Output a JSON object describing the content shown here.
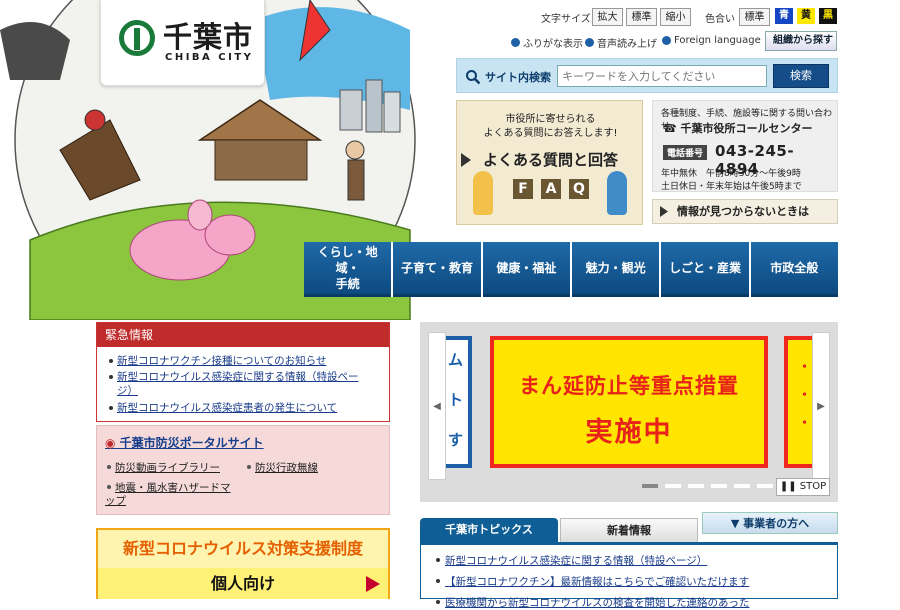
{
  "logo": {
    "ja": "千葉市",
    "en": "CHIBA CITY"
  },
  "utility": {
    "font_size_label": "文字サイズ",
    "font_sizes": [
      "拡大",
      "標準",
      "縮小"
    ],
    "color_label": "色合い",
    "colors": [
      {
        "label": "標準",
        "bg": "#f4f4f4",
        "fg": "#222"
      },
      {
        "label": "青",
        "bg": "#1445c4",
        "fg": "#ffffff"
      },
      {
        "label": "黄",
        "bg": "#ffe800",
        "fg": "#111"
      },
      {
        "label": "黒",
        "bg": "#111111",
        "fg": "#ffe800"
      }
    ],
    "links": [
      "ふりがな表示",
      "音声読み上げ",
      "Foreign language"
    ],
    "org_button": "組織から探す"
  },
  "search": {
    "label": "サイト内検索",
    "placeholder": "キーワードを入力してください",
    "button": "検索"
  },
  "faq": {
    "line1": "市役所に寄せられる",
    "line2": "よくある質問にお答えします!",
    "title": "よくある質問と回答",
    "letters": [
      "F",
      "A",
      "Q"
    ]
  },
  "call_center": {
    "line1": "各種制度、手続、施設等に関する問い合わせ",
    "title": "千葉市役所コールセンター",
    "tag": "電話番号",
    "number": "043-245-4894",
    "hours1": "年中無休　午前8時30分～午後9時",
    "hours2": "土日休日・年末年始は午後5時まで"
  },
  "not_found": "情報が見つからないときは",
  "nav": [
    {
      "label1": "くらし・地域・",
      "label2": "手続"
    },
    {
      "label1": "子育て・教育",
      "label2": ""
    },
    {
      "label1": "健康・福祉",
      "label2": ""
    },
    {
      "label1": "魅力・観光",
      "label2": ""
    },
    {
      "label1": "しごと・産業",
      "label2": ""
    },
    {
      "label1": "市政全般",
      "label2": ""
    }
  ],
  "emergency": {
    "header": "緊急情報",
    "items": [
      "新型コロナワクチン接種についてのお知らせ",
      "新型コロナウイルス感染症に関する情報（特設ペー",
      "ジ）",
      "新型コロナウイルス感染症患者の発生について"
    ]
  },
  "bousai": {
    "title": "千葉市防災ポータルサイト",
    "links": [
      "防災動画ライブラリー",
      "防災行政無線",
      "地震・風水害ハザードマ",
      "ップ"
    ]
  },
  "corona": {
    "header": "新型コロナウイルス対策支援制度",
    "button": "個人向け"
  },
  "slider": {
    "line1": "まん延防止等重点措置",
    "line2": "実施中",
    "stop": "STOP",
    "left_partial": [
      "ム",
      "ト",
      "す"
    ],
    "right_partial": [
      "・",
      "・",
      "・"
    ],
    "prev": "◀",
    "next": "▶"
  },
  "tabs": [
    "千葉市トピックス",
    "新着情報",
    "事業者の方へ"
  ],
  "topics": [
    "新型コロナウイルス感染症に関する情報（特設ページ）",
    "【新型コロナワクチン】最新情報はこちらでご確認いただけます",
    "医療機関から新型コロナウイルスの検査を開始した連絡のあった"
  ]
}
